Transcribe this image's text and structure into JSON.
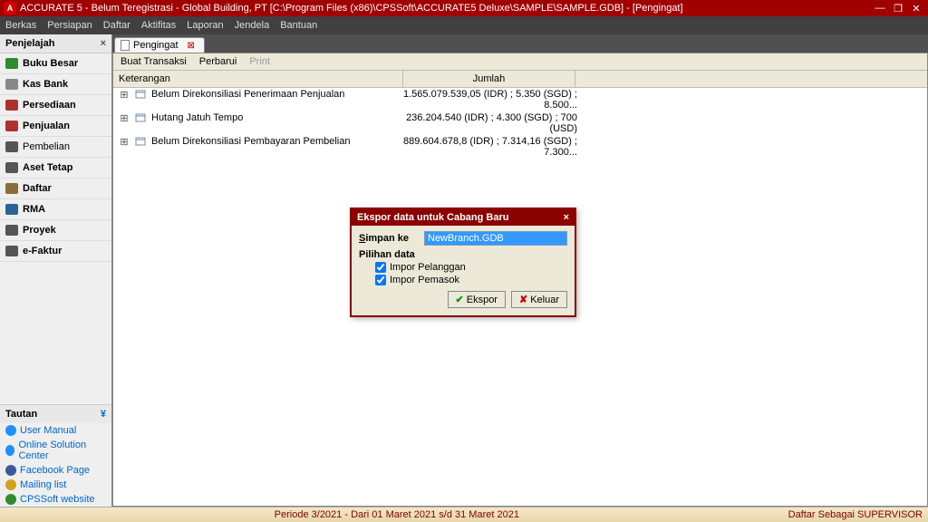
{
  "titlebar": {
    "app_icon": "A",
    "text": "ACCURATE 5  - Belum Teregistrasi - Global Building, PT  [C:\\Program Files (x86)\\CPSSoft\\ACCURATE5 Deluxe\\SAMPLE\\SAMPLE.GDB] - [Pengingat]"
  },
  "menubar": {
    "items": [
      "Berkas",
      "Persiapan",
      "Daftar",
      "Aktifitas",
      "Laporan",
      "Jendela",
      "Bantuan"
    ]
  },
  "sidebar": {
    "header": "Penjelajah",
    "items": [
      {
        "label": "Buku Besar",
        "bold": true,
        "color": "#2e8b2e"
      },
      {
        "label": "Kas Bank",
        "bold": true,
        "color": "#888"
      },
      {
        "label": "Persediaan",
        "bold": true,
        "color": "#b03030"
      },
      {
        "label": "Penjualan",
        "bold": true,
        "color": "#b03030"
      },
      {
        "label": "Pembelian",
        "bold": false,
        "color": "#555"
      },
      {
        "label": "Aset Tetap",
        "bold": true,
        "color": "#555"
      },
      {
        "label": "Daftar",
        "bold": true,
        "color": "#8a6d3b"
      },
      {
        "label": "RMA",
        "bold": true,
        "color": "#2a6496"
      },
      {
        "label": "Proyek",
        "bold": true,
        "color": "#555"
      },
      {
        "label": "e-Faktur",
        "bold": true,
        "color": "#555"
      }
    ],
    "tautan_header": "Tautan",
    "links": [
      {
        "label": "User Manual",
        "icon": "help"
      },
      {
        "label": "Online Solution Center",
        "icon": "help"
      },
      {
        "label": "Facebook Page",
        "icon": "fb"
      },
      {
        "label": "Mailing list",
        "icon": "mail"
      },
      {
        "label": "CPSSoft website",
        "icon": "web"
      }
    ]
  },
  "tab": {
    "label": "Pengingat"
  },
  "doc_toolbar": {
    "buat": "Buat Transaksi",
    "perbarui": "Perbarui",
    "print": "Print"
  },
  "grid": {
    "col_desc": "Keterangan",
    "col_amt": "Jumlah",
    "rows": [
      {
        "desc": "Belum Direkonsiliasi Penerimaan Penjualan",
        "amt": "1.565.079.539,05 (IDR) ; 5.350 (SGD) ; 8.500..."
      },
      {
        "desc": "Hutang Jatuh Tempo",
        "amt": "236.204.540 (IDR) ; 4.300 (SGD) ; 700 (USD)"
      },
      {
        "desc": "Belum Direkonsiliasi Pembayaran Pembelian",
        "amt": "889.604.678,8 (IDR) ; 7.314,16 (SGD) ; 7.300..."
      }
    ]
  },
  "dialog": {
    "title": "Ekspor data untuk Cabang Baru",
    "simpan_label": "Simpan ke",
    "simpan_value": "NewBranch.GDB",
    "pilihan_label": "Pilihan data",
    "chk1": "Impor Pelanggan",
    "chk2": "Impor Pemasok",
    "ekspor": "Ekspor",
    "keluar": "Keluar"
  },
  "statusbar": {
    "period": "Periode 3/2021 - Dari 01 Maret 2021 s/d 31 Maret 2021",
    "user": "Daftar Sebagai SUPERVISOR"
  }
}
